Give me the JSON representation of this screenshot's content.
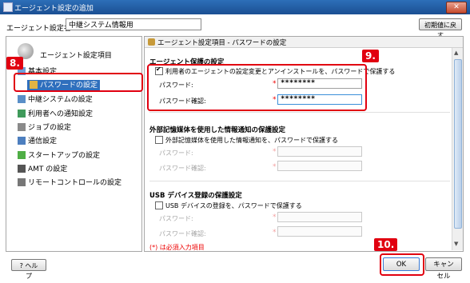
{
  "window": {
    "title": "エージェント設定の追加",
    "close_label": "✕"
  },
  "header": {
    "name_label": "エージェント設定名:",
    "required_mark": "*",
    "name_value": "中継システム情報用",
    "reset_button": "初期値に戻す"
  },
  "sidebar": {
    "title": "エージェント設定項目",
    "items": [
      {
        "label": "基本設定",
        "icon": "basic-settings-icon"
      },
      {
        "label": "パスワードの設定",
        "icon": "key-icon"
      },
      {
        "label": "中継システムの設定",
        "icon": "relay-system-icon"
      },
      {
        "label": "利用者への通知設定",
        "icon": "user-notification-icon"
      },
      {
        "label": "ジョブの設定",
        "icon": "job-icon"
      },
      {
        "label": "通信設定",
        "icon": "communication-icon"
      },
      {
        "label": "スタートアップの設定",
        "icon": "startup-icon"
      },
      {
        "label": "AMT の設定",
        "icon": "amt-icon"
      },
      {
        "label": "リモートコントロールの設定",
        "icon": "remote-control-icon"
      }
    ],
    "selected_index": 1
  },
  "content": {
    "breadcrumb": "エージェント設定項目 - パスワードの設定",
    "sections": [
      {
        "title": "エージェント保護の設定",
        "checkbox_label": "利用者のエージェントの設定変更とアンインストールを、パスワードで保護する",
        "checked": true,
        "password_label": "パスワード:",
        "password_value": "********",
        "confirm_label": "パスワード確認:",
        "confirm_value": "********"
      },
      {
        "title": "外部記憶媒体を使用した情報通知の保護設定",
        "checkbox_label": "外部記憶媒体を使用した情報通知を、パスワードで保護する",
        "checked": false,
        "password_label": "パスワード:",
        "password_value": "",
        "confirm_label": "パスワード確認:",
        "confirm_value": ""
      },
      {
        "title": "USB デバイス登録の保護設定",
        "checkbox_label": "USB デバイスの登録を、パスワードで保護する",
        "checked": false,
        "password_label": "パスワード:",
        "password_value": "",
        "confirm_label": "パスワード確認:",
        "confirm_value": ""
      }
    ],
    "required_mark": "*",
    "required_note": "(*) は必須入力項目"
  },
  "footer": {
    "help_button": "? ヘルプ",
    "ok_button": "OK",
    "cancel_button": "キャンセル"
  },
  "callouts": [
    "8.",
    "9.",
    "10."
  ],
  "colors": {
    "title_bar": "#1b4f93",
    "selection": "#2f6fbd",
    "callout": "#e10010",
    "required": "#ee0000"
  }
}
